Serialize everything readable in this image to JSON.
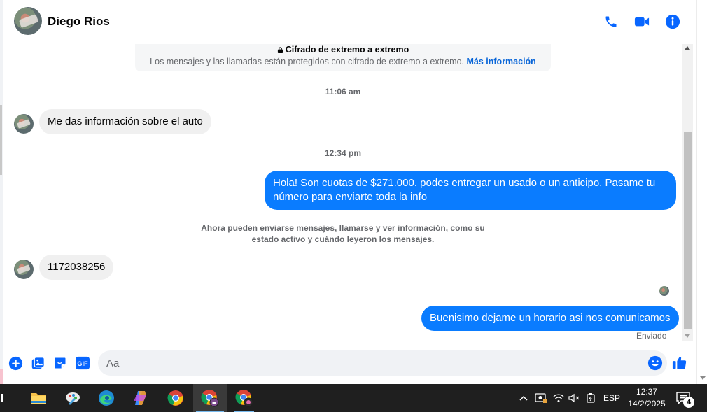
{
  "header": {
    "contact_name": "Diego Rios",
    "icons": [
      "phone-icon",
      "video-icon",
      "info-icon"
    ]
  },
  "encryption": {
    "title": "Cifrado de extremo a extremo",
    "text": "Los mensajes y las llamadas están protegidos con cifrado de extremo a extremo.",
    "link": "Más información"
  },
  "thread": {
    "time1": "11:06 am",
    "msg_in_1": "Me das información sobre el auto",
    "time2": "12:34 pm",
    "msg_out_1": "Hola! Son cuotas de $271.000. podes entregar un usado o un anticipo. Pasame tu número para enviarte toda la info",
    "notice": "Ahora pueden enviarse mensajes, llamarse y ver información, como su estado activo y cuándo leyeron los mensajes.",
    "msg_in_2": "1172038256",
    "msg_out_2": "Buenisimo dejame un horario asi nos comunicamos",
    "status": "Enviado"
  },
  "composer": {
    "placeholder": "Aa",
    "icons": [
      "plus-icon",
      "image-icon",
      "sticker-icon",
      "gif-icon",
      "emoji-icon",
      "like-icon"
    ],
    "gif_label": "GIF"
  },
  "taskbar": {
    "apps": [
      "task-view-icon",
      "file-explorer-icon",
      "paint-icon",
      "edge-icon",
      "copilot-icon",
      "chrome-icon",
      "chrome-profile-icon",
      "chrome-profile-2-icon"
    ],
    "language": "ESP",
    "time": "12:37",
    "date": "14/2/2025",
    "notification_count": "4"
  },
  "colors": {
    "accent": "#0a7cff",
    "icon_blue": "#0866ff",
    "incoming_bubble": "#f0f0f0",
    "taskbar": "#1f1f1f"
  }
}
